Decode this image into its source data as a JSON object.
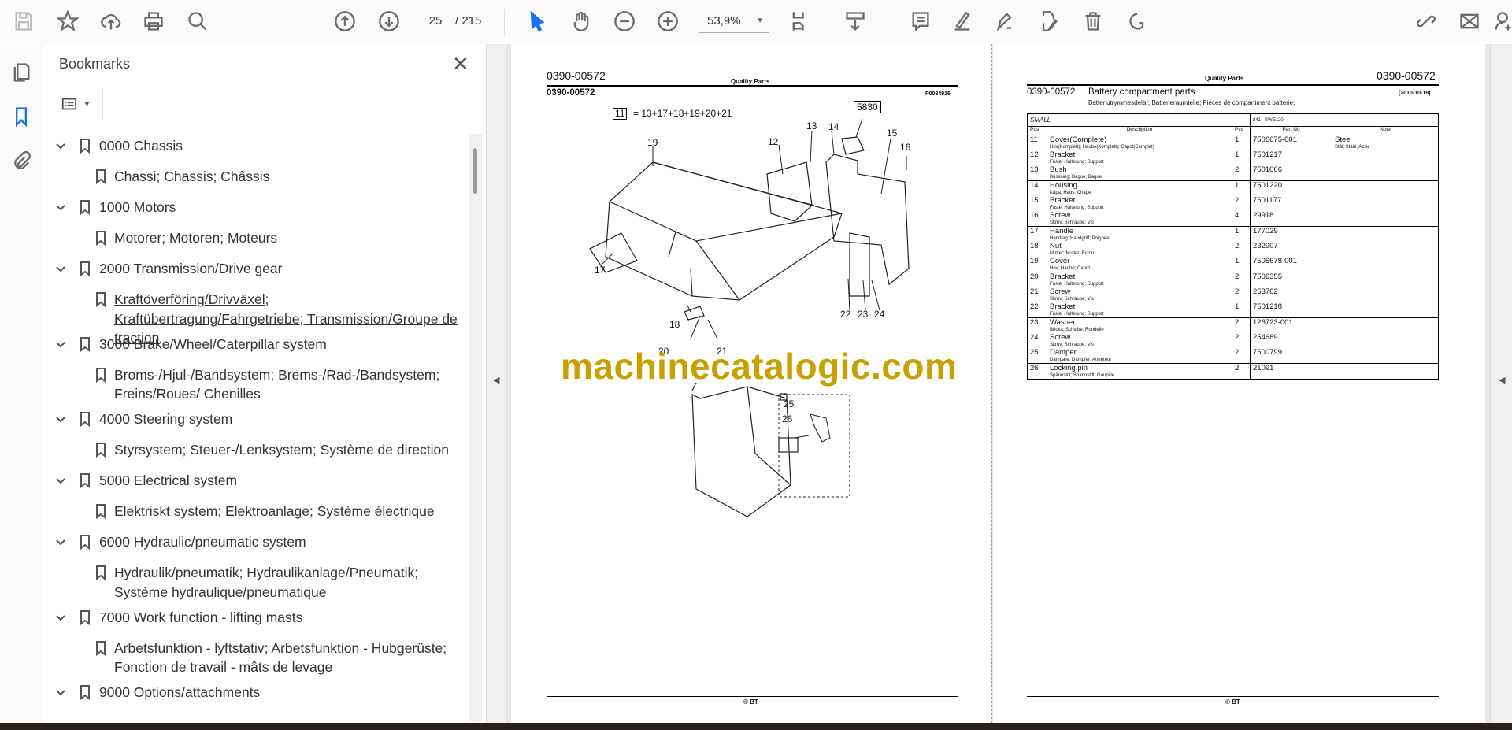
{
  "toolbar": {
    "page_current": "25",
    "page_total": "/ 215",
    "zoom": "53,9%"
  },
  "bookmarks": {
    "title": "Bookmarks",
    "items": [
      {
        "label": "0000 Chassis",
        "children": [
          "Chassi; Chassis; Châssis"
        ]
      },
      {
        "label": "1000 Motors",
        "children": [
          "Motorer; Motoren; Moteurs"
        ]
      },
      {
        "label": "2000 Transmission/Drive gear",
        "children": [
          "Kraftöverföring/Drivväxel; Kraftübertragung/Fahrgetriebe; Transmission/Groupe de traction"
        ]
      },
      {
        "label": "3000 Brake/Wheel/Caterpillar system",
        "children": [
          "Broms-/Hjul-/Bandsystem; Brems-/Rad-/Bandsystem; Freins/Roues/ Chenilles"
        ]
      },
      {
        "label": "4000 Steering system",
        "children": [
          "Styrsystem; Steuer-/Lenksystem; Système de direction"
        ]
      },
      {
        "label": "5000 Electrical system",
        "children": [
          "Elektriskt system; Elektroanlage; Système électrique"
        ]
      },
      {
        "label": "6000 Hydraulic/pneumatic system",
        "children": [
          "Hydraulik/pneumatik; Hydraulikanlage/Pneumatik; Système hydraulique/pneumatique"
        ]
      },
      {
        "label": "7000 Work function - lifting masts",
        "children": [
          "Arbetsfunktion - lyftstativ; Arbetsfunktion - Hubgerüste; Fonction de travail - mâts de levage"
        ]
      },
      {
        "label": "9000 Options/attachments",
        "children": []
      }
    ]
  },
  "left_page": {
    "code_top": "0390-00572",
    "header": "Quality Parts",
    "code": "0390-00572",
    "drawing_no": "P0034916",
    "formula_box": "11",
    "formula": "= 13+17+18+19+20+21",
    "ref_box": "5830",
    "callouts": [
      "19",
      "12",
      "13",
      "14",
      "15",
      "16",
      "17",
      "18",
      "20",
      "21",
      "22",
      "23",
      "24",
      "25",
      "26"
    ],
    "footer": "© BT"
  },
  "watermark": "machinecatalogic.com",
  "right_page": {
    "header": "Quality Parts",
    "code_top": "0390-00572",
    "code": "0390-00572",
    "title": "Battery compartment parts",
    "date": "[2010-10-19]",
    "subtitle": "Batteriutrymmesdelar; Batterieraumteile; Pièces de compartiment batterie;",
    "variant": "SMALL",
    "model_no": "841",
    "model": "SWE120",
    "model_dash": "-",
    "columns": [
      "Pos",
      "Description",
      "Pcs",
      "Part No",
      "Note"
    ],
    "rows": [
      {
        "pos": "11",
        "desc": "Cover(Complete)",
        "trans": "Huv(Komplett); Haube(Komplett); Capot(Complet)",
        "pcs": "1",
        "part": "7506675-001",
        "note": "Steel",
        "note_trans": "Stål; Stahl; Acier",
        "grp": true
      },
      {
        "pos": "12",
        "desc": "Bracket",
        "trans": "Fäste; Halterung; Support",
        "pcs": "1",
        "part": "7501217"
      },
      {
        "pos": "13",
        "desc": "Bush",
        "trans": "Bussning; Bague; Bague",
        "pcs": "2",
        "part": "7501066"
      },
      {
        "pos": "14",
        "desc": "Housing",
        "trans": "Kåpa; Haus; Chape",
        "pcs": "1",
        "part": "7501220",
        "grp": true
      },
      {
        "pos": "15",
        "desc": "Bracket",
        "trans": "Fäste; Halterung; Support",
        "pcs": "2",
        "part": "7501177"
      },
      {
        "pos": "16",
        "desc": "Screw",
        "trans": "Skruv; Schraube; Vis",
        "pcs": "4",
        "part": "29918"
      },
      {
        "pos": "17",
        "desc": "Handle",
        "trans": "Handtag; Handgriff; Poignée.",
        "pcs": "1",
        "part": "177029",
        "grp": true
      },
      {
        "pos": "18",
        "desc": "Nut",
        "trans": "Mutter; Mutter; Ecrou",
        "pcs": "2",
        "part": "232907"
      },
      {
        "pos": "19",
        "desc": "Cover",
        "trans": "Huv; Haube; Capot",
        "pcs": "1",
        "part": "7506678-001"
      },
      {
        "pos": "20",
        "desc": "Bracket",
        "trans": "Fäste; Halterung; Support",
        "pcs": "2",
        "part": "7506355",
        "grp": true
      },
      {
        "pos": "21",
        "desc": "Screw",
        "trans": "Skruv; Schraube; Vis",
        "pcs": "2",
        "part": "253762"
      },
      {
        "pos": "22",
        "desc": "Bracket",
        "trans": "Fäste; Halterung; Support",
        "pcs": "1",
        "part": "7501218"
      },
      {
        "pos": "23",
        "desc": "Washer",
        "trans": "Bricka; Scheibe; Rondelle",
        "pcs": "2",
        "part": "126723-001",
        "grp": true
      },
      {
        "pos": "24",
        "desc": "Screw",
        "trans": "Skruv; Schraube; Vis",
        "pcs": "2",
        "part": "254689"
      },
      {
        "pos": "25",
        "desc": "Damper",
        "trans": "Dämpare; Dämpfer; Attenteur",
        "pcs": "2",
        "part": "7500799"
      },
      {
        "pos": "26",
        "desc": "Locking pin",
        "trans": "Spännstift; Spannstift; Goupille",
        "pcs": "2",
        "part": "21091",
        "grp": true
      }
    ],
    "footer": "© BT"
  }
}
